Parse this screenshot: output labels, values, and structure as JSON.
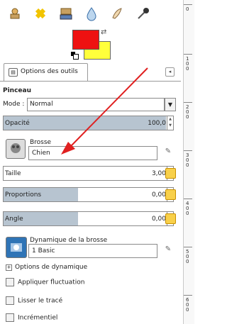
{
  "toolbox": {
    "icons": [
      "clone-stamp-icon",
      "healing-icon",
      "perspective-clone-icon",
      "blur-icon",
      "smudge-icon",
      "dodge-burn-icon"
    ]
  },
  "colors": {
    "foreground": "#ee1111",
    "background": "#ffff3b"
  },
  "tab": {
    "label": "Options des outils"
  },
  "tool_options": {
    "section_title": "Pinceau",
    "mode_label": "Mode :",
    "mode_value": "Normal",
    "opacity": {
      "label": "Opacité",
      "value": "100,0",
      "fill_percent": 100
    },
    "brush": {
      "label": "Brosse",
      "value": "Chien"
    },
    "size": {
      "label": "Taille",
      "value": "3,00",
      "fill_percent": 0
    },
    "aspect": {
      "label": "Proportions",
      "value": "0,00",
      "fill_percent": 44
    },
    "angle": {
      "label": "Angle",
      "value": "0,00",
      "fill_percent": 44
    },
    "dynamics": {
      "label": "Dynamique de la brosse",
      "value": "1 Basic"
    },
    "dynamics_options_label": "Options de dynamique",
    "apply_jitter_label": "Appliquer fluctuation",
    "smooth_stroke_label": "Lisser le tracé",
    "incremental_label": "Incrémentiel"
  },
  "ruler": {
    "labels": [
      "0",
      "1 0 0",
      "2 0 0",
      "3 0 0",
      "4 0 0",
      "5 0 0",
      "6 0 0"
    ]
  },
  "annotation": {
    "arrow_color": "#e02020"
  }
}
